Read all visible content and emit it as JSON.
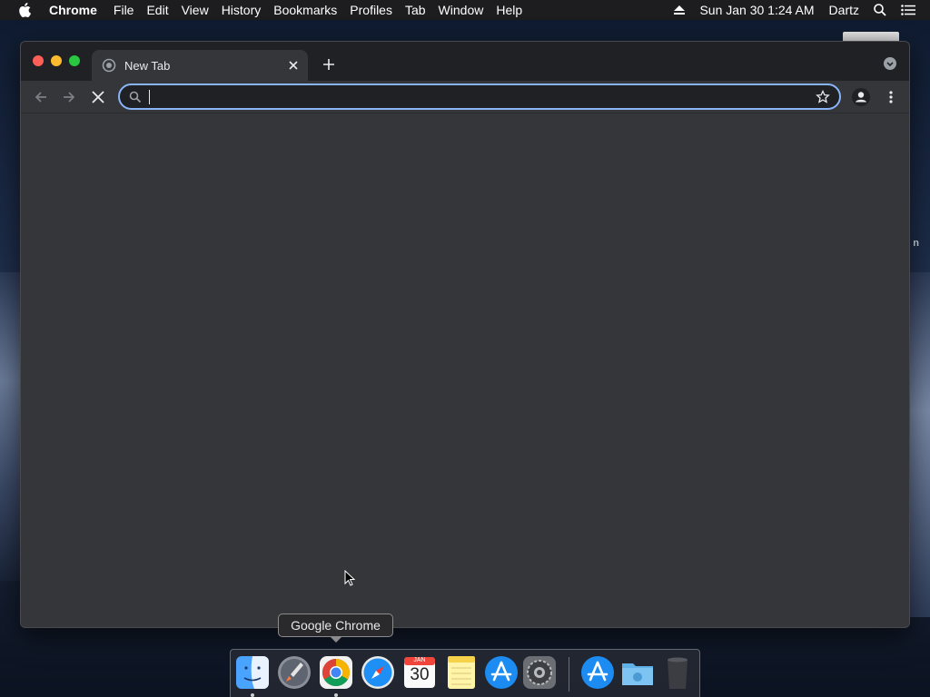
{
  "menubar": {
    "app_name": "Chrome",
    "items": [
      "File",
      "Edit",
      "View",
      "History",
      "Bookmarks",
      "Profiles",
      "Tab",
      "Window",
      "Help"
    ],
    "clock": "Sun Jan 30  1:24 AM",
    "user": "Dartz",
    "icons": [
      "apple-icon",
      "eject-icon",
      "spotlight-search-icon",
      "notification-center-icon"
    ]
  },
  "browser": {
    "tab": {
      "title": "New Tab",
      "favicon": "chrome-loading-icon"
    },
    "omnibox": {
      "value": "",
      "placeholder": ""
    },
    "toolbar_icons": [
      "back-arrow-icon",
      "forward-arrow-icon",
      "stop-loading-icon",
      "search-icon",
      "bookmark-star-icon",
      "profile-icon",
      "kebab-menu-icon",
      "tab-search-icon"
    ]
  },
  "dock": {
    "tooltip": "Google Chrome",
    "apps": [
      "Finder",
      "Launchpad",
      "Google Chrome",
      "Safari",
      "Calendar",
      "Notes",
      "App Store",
      "System Preferences",
      "App Store",
      "Downloads",
      "Trash"
    ],
    "calendar": {
      "month": "JAN",
      "day": "30"
    }
  },
  "desktop": {
    "partial_label": "n"
  },
  "colors": {
    "window_bg": "#35363a",
    "tabstrip_bg": "#202124",
    "focus_ring": "#8ab4f8",
    "menubar_bg": "#1d1d1f"
  }
}
